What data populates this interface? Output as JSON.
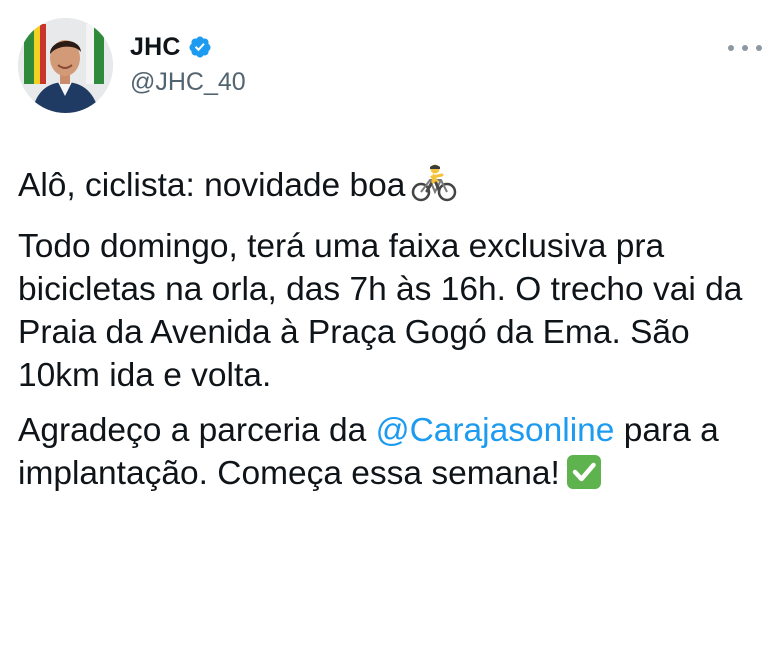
{
  "author": {
    "display_name": "JHC",
    "handle": "@JHC_40",
    "verified": true
  },
  "tweet": {
    "line1": "Alô, ciclista: novidade boa",
    "line1_emoji": "bicyclist-emoji",
    "para2": "Todo domingo, terá uma faixa exclusiva pra bicicletas na orla, das 7h às 16h. O trecho vai da Praia da Avenida à Praça Gogó da Ema. São 10km ida e volta.",
    "para3_before": "Agradeço a parceria da ",
    "para3_mention": "@Carajasonline",
    "para3_after": " para a implantação. Começa essa semana!",
    "para3_emoji": "check-mark-button-emoji"
  },
  "colors": {
    "link": "#1d9bf0",
    "verified": "#1d9bf0",
    "check_emoji": "#5fb34f",
    "text": "#0f1419",
    "secondary": "#536471"
  },
  "icons": {
    "more": "more-options-icon",
    "verified": "verified-badge-icon"
  }
}
